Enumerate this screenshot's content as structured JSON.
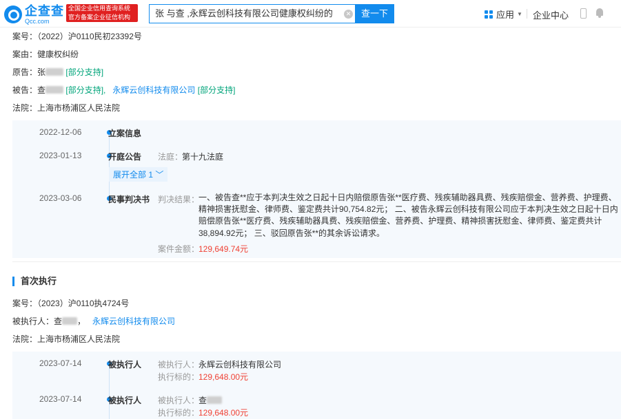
{
  "header": {
    "logo_cn": "企查查",
    "logo_en": "Qcc.com",
    "badge_line1": "全国企业信用查询系统",
    "badge_line2": "官方备案企业征信机构",
    "search_value": "张  与查  ,永辉云创科技有限公司健康权纠纷的",
    "search_button": "查一下",
    "app_label": "应用",
    "enterprise_center": "企业中心"
  },
  "case1": {
    "case_no_label": "案号：",
    "case_no": "（2022）沪0110民初23392号",
    "cause_label": "案由：",
    "cause": "健康权纠纷",
    "plaintiff_label": "原告：",
    "plaintiff_name": "张",
    "plaintiff_tag": "[部分支持]",
    "defendant_label": "被告：",
    "defendant1_name": "查",
    "defendant1_tag": "[部分支持],",
    "defendant2_name": "永辉云创科技有限公司",
    "defendant2_tag": "[部分支持]",
    "court_label": "法院：",
    "court": "上海市杨浦区人民法院",
    "timeline": [
      {
        "date": "2022-12-06",
        "type": "立案信息"
      },
      {
        "date": "2023-01-13",
        "type": "开庭公告",
        "court_label": "法庭：",
        "court_value": "第十九法庭",
        "expand": "展开全部 1"
      },
      {
        "date": "2023-03-06",
        "type": "民事判决书",
        "result_label": "判决结果：",
        "result_text": "一、被告查**应于本判决生效之日起十日内赔偿原告张**医疗费、残疾辅助器具费、残疾赔偿金、营养费、护理费、精神损害抚慰金、律师费、鉴定费共计90,754.82元； 二、被告永辉云创科技有限公司应于本判决生效之日起十日内赔偿原告张**医疗费、残疾辅助器具费、残疾赔偿金、营养费、护理费、精神损害抚慰金、律师费、鉴定费共计38,894.92元； 三、驳回原告张**的其余诉讼请求。",
        "amount_label": "案件金额：",
        "amount": "129,649.74元"
      }
    ]
  },
  "case2": {
    "section_title": "首次执行",
    "case_no_label": "案号：",
    "case_no": "（2023）沪0110执4724号",
    "executee_label": "被执行人：",
    "executee1": "查",
    "executee2": "永辉云创科技有限公司",
    "court_label": "法院：",
    "court": "上海市杨浦区人民法院",
    "timeline": [
      {
        "date": "2023-07-14",
        "type": "被执行人",
        "who_label": "被执行人：",
        "who": "永辉云创科技有限公司",
        "amount_label": "执行标的：",
        "amount": "129,648.00元"
      },
      {
        "date": "2023-07-14",
        "type": "被执行人",
        "who_label": "被执行人：",
        "who": "查",
        "amount_label": "执行标的：",
        "amount": "129,648.00元"
      }
    ]
  }
}
